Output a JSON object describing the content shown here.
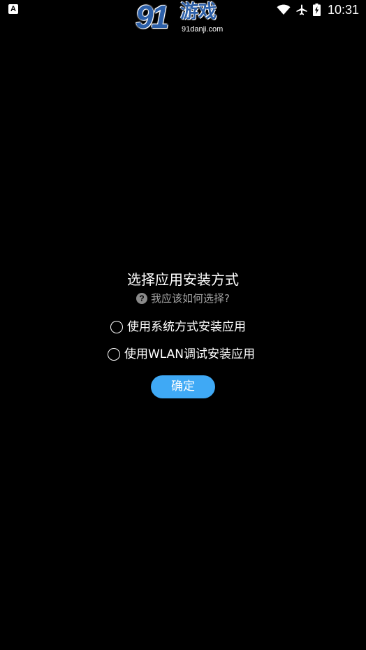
{
  "status_bar": {
    "notification_icon": "A",
    "icons": [
      "wifi-icon",
      "airplane-icon",
      "battery-charging-icon"
    ],
    "time": "10:31"
  },
  "watermark": {
    "number": "91",
    "brand": "游戏",
    "domain": "91danji.com"
  },
  "dialog": {
    "title": "选择应用安装方式",
    "help_text": "我应该如何选择?",
    "options": [
      {
        "label": "使用系统方式安装应用",
        "selected": false
      },
      {
        "label": "使用WLAN调试安装应用",
        "selected": false
      }
    ],
    "confirm_label": "确定"
  },
  "colors": {
    "background": "#000000",
    "text": "#ffffff",
    "muted_text": "#a0a0a0",
    "accent": "#3fa9f5"
  }
}
